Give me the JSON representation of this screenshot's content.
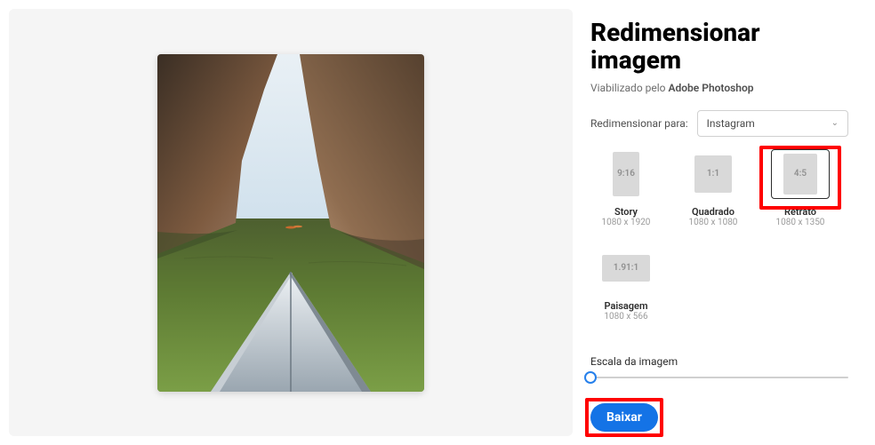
{
  "header": {
    "title": "Redimensionar imagem",
    "subtitle_prefix": "Viabilizado pelo ",
    "subtitle_brand": "Adobe Photoshop"
  },
  "controls": {
    "resize_for_label": "Redimensionar para:",
    "resize_for_value": "Instagram",
    "scale_label": "Escala da imagem",
    "download_label": "Baixar"
  },
  "options": [
    {
      "ratio": "9:16",
      "name": "Story",
      "dimensions": "1080 x 1920",
      "shape": "t-story",
      "selected": false,
      "highlight": false
    },
    {
      "ratio": "1:1",
      "name": "Quadrado",
      "dimensions": "1080 x 1080",
      "shape": "t-square",
      "selected": false,
      "highlight": false
    },
    {
      "ratio": "4:5",
      "name": "Retrato",
      "dimensions": "1080 x 1350",
      "shape": "t-portrait",
      "selected": true,
      "highlight": true
    },
    {
      "ratio": "1.91:1",
      "name": "Paisagem",
      "dimensions": "1080 x 566",
      "shape": "t-land",
      "selected": false,
      "highlight": false
    }
  ]
}
